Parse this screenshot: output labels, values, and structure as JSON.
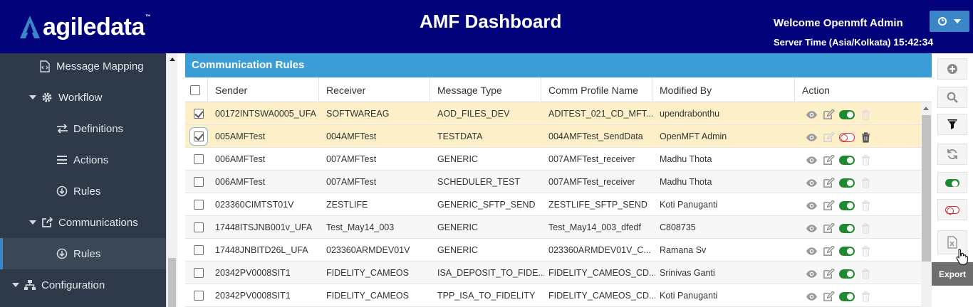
{
  "header": {
    "logo_text": "agiledata",
    "logo_tm": "™",
    "title": "AMF Dashboard",
    "welcome": "Welcome Openmft Admin",
    "server_time_label": "Server Time (Asia/Kolkata)",
    "server_time_value": "15:42:34"
  },
  "sidebar": {
    "items": [
      {
        "label": "Message Mapping",
        "icon": "code-file-icon"
      },
      {
        "label": "Workflow",
        "icon": "gear-icon"
      },
      {
        "label": "Definitions",
        "icon": "arrows-icon"
      },
      {
        "label": "Actions",
        "icon": "list-icon"
      },
      {
        "label": "Rules",
        "icon": "circle-down-icon"
      },
      {
        "label": "Communications",
        "icon": "share-icon"
      },
      {
        "label": "Rules",
        "icon": "circle-down-icon"
      },
      {
        "label": "Configuration",
        "icon": "sitemap-icon"
      }
    ]
  },
  "panel": {
    "title": "Communication Rules"
  },
  "table": {
    "headers": [
      "Sender",
      "Receiver",
      "Message Type",
      "Comm Profile Name",
      "Modified By",
      "Action"
    ],
    "rows": [
      {
        "sender": "00172INTSWA0005_UFA",
        "receiver": "SOFTWAREAG",
        "type": "AOD_FILES_DEV",
        "profile": "ADITEST_021_CD_MFT...",
        "modified": "upendrabonthu",
        "checked": true,
        "status": "on"
      },
      {
        "sender": "005AMFTest",
        "receiver": "004AMFTest",
        "type": "TESTDATA",
        "profile": "004AMFTest_SendData",
        "modified": "OpenMFT Admin",
        "checked": true,
        "status": "off"
      },
      {
        "sender": "006AMFTest",
        "receiver": "007AMFTest",
        "type": "GENERIC",
        "profile": "007AMFTest_receiver",
        "modified": "Madhu Thota",
        "checked": false,
        "status": "on"
      },
      {
        "sender": "006AMFTest",
        "receiver": "007AMFTest",
        "type": "SCHEDULER_TEST",
        "profile": "007AMFTest_receiver",
        "modified": "Madhu Thota",
        "checked": false,
        "status": "on"
      },
      {
        "sender": "023360CIMTST01V",
        "receiver": "ZESTLIFE",
        "type": "GENERIC_SFTP_SEND",
        "profile": "ZESTLIFE_SFTP_SEND",
        "modified": "Koti Panuganti",
        "checked": false,
        "status": "on"
      },
      {
        "sender": "17448ITSJNB001v_UFA",
        "receiver": "Test_May14_003",
        "type": "GENERIC",
        "profile": "Test_May14_003_dfedf",
        "modified": "C808735",
        "checked": false,
        "status": "on"
      },
      {
        "sender": "17448JNBITD26L_UFA",
        "receiver": "023360ARMDEV01V",
        "type": "GENERIC",
        "profile": "023360ARMDEV01V_C...",
        "modified": "Ramana Sv",
        "checked": false,
        "status": "on"
      },
      {
        "sender": "20342PV0008SIT1",
        "receiver": "FIDELITY_CAMEOS",
        "type": "ISA_DEPOSIT_TO_FIDE...",
        "profile": "FIDELITY_CAMEOS_CD...",
        "modified": "Srinivas Ganti",
        "checked": false,
        "status": "on"
      },
      {
        "sender": "20342PV0008SIT1",
        "receiver": "FIDELITY_CAMEOS",
        "type": "TPP_ISA_TO_FIDELITY",
        "profile": "FIDELITY_CAMEOS_CD...",
        "modified": "Koti Panuganti",
        "checked": false,
        "status": "on"
      }
    ]
  },
  "toolbar": {
    "buttons": [
      "add-icon",
      "search-icon",
      "filter-icon",
      "refresh-icon",
      "toggle-on-icon",
      "toggle-off-icon",
      "excel-export-icon"
    ],
    "tooltip": "Export"
  },
  "colors": {
    "header_bg": "#02037a",
    "sidebar_bg": "#2e3949",
    "panel_title_bg": "#3a9dd6",
    "selected_row_bg": "#fdf0c8",
    "toggle_on": "#1e8a2e",
    "toggle_off": "#d82727"
  }
}
